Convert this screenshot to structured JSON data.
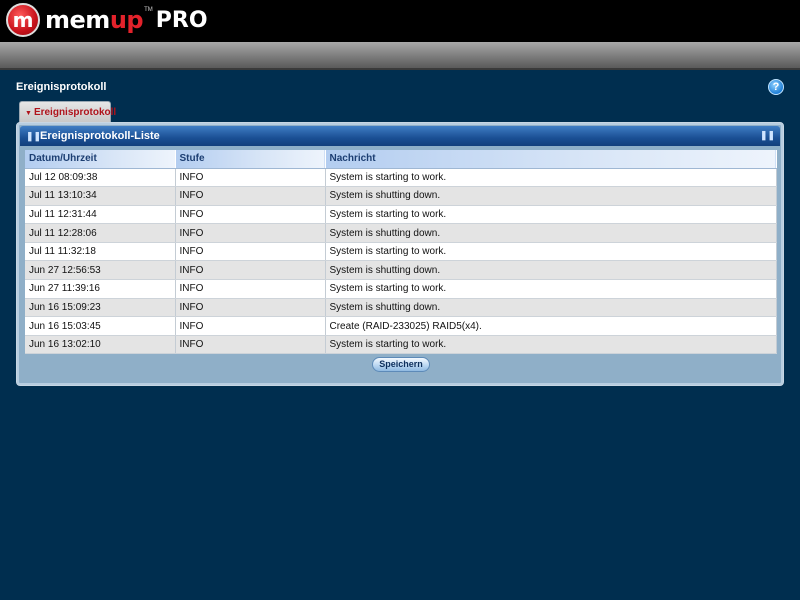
{
  "brand": {
    "logo_letter": "m",
    "word_white_1": "me",
    "word_white_2": "m",
    "word_red": "up",
    "tm": "TM",
    "pro": "PRO"
  },
  "page": {
    "title": "Ereignisprotokoll",
    "help_glyph": "?"
  },
  "tabs": [
    {
      "label": "Ereignisprotokoll",
      "active": true
    }
  ],
  "panel": {
    "title": "Ereignisprotokoll-Liste",
    "columns": [
      "Datum/Uhrzeit",
      "Stufe",
      "Nachricht"
    ],
    "rows": [
      [
        "Jul 12 08:09:38",
        "INFO",
        "System is starting to work."
      ],
      [
        "Jul 11 13:10:34",
        "INFO",
        "System is shutting down."
      ],
      [
        "Jul 11 12:31:44",
        "INFO",
        "System is starting to work."
      ],
      [
        "Jul 11 12:28:06",
        "INFO",
        "System is shutting down."
      ],
      [
        "Jul 11 11:32:18",
        "INFO",
        "System is starting to work."
      ],
      [
        "Jun 27 12:56:53",
        "INFO",
        "System is shutting down."
      ],
      [
        "Jun 27 11:39:16",
        "INFO",
        "System is starting to work."
      ],
      [
        "Jun 16 15:09:23",
        "INFO",
        "System is shutting down."
      ],
      [
        "Jun 16 15:03:45",
        "INFO",
        "Create (RAID-233025) RAID5(x4)."
      ],
      [
        "Jun 16 13:02:10",
        "INFO",
        "System is starting to work."
      ]
    ],
    "save_label": "Speichern"
  },
  "colors": {
    "background": "#002e4f",
    "header_blue": "#1a4f94",
    "tab_text_red": "#b0131b",
    "brand_red": "#e3222b"
  },
  "icons": {
    "help": "help-icon",
    "panel_left": "collapse-handle-icon",
    "panel_right": "expand-handle-icon",
    "tab_arrow": "triangle-down-icon"
  }
}
